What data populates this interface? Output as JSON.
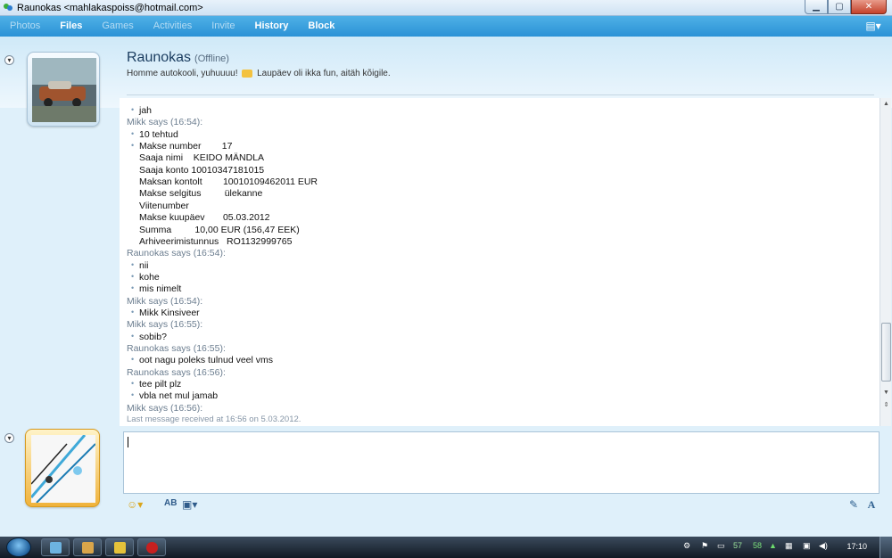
{
  "window": {
    "title": "Raunokas <mahlakaspoiss@hotmail.com>"
  },
  "menu": {
    "items": [
      "Photos",
      "Files",
      "Games",
      "Activities",
      "Invite",
      "History",
      "Block"
    ]
  },
  "contact": {
    "name": "Raunokas",
    "status": "(Offline)",
    "message_part1": "Homme autokooli, yuhuuuu!",
    "message_part2": "Laupäev oli ikka fun, aitäh kõigile."
  },
  "conversation": [
    {
      "type": "msg",
      "text": "jah"
    },
    {
      "type": "says",
      "text": "Mikk says (16:54):"
    },
    {
      "type": "msg",
      "text": "10 tehtud"
    },
    {
      "type": "msg",
      "text": "Makse number        17"
    },
    {
      "type": "cont",
      "text": "Saaja nimi    KEIDO MÄNDLA"
    },
    {
      "type": "cont",
      "text": "Saaja konto 10010347181015"
    },
    {
      "type": "cont",
      "text": "Maksan kontolt        10010109462011 EUR"
    },
    {
      "type": "cont",
      "text": "Makse selgitus         ülekanne"
    },
    {
      "type": "cont",
      "text": "Viitenumber"
    },
    {
      "type": "cont",
      "text": "Makse kuupäev       05.03.2012"
    },
    {
      "type": "cont",
      "text": "Summa         10,00 EUR (156,47 EEK)"
    },
    {
      "type": "cont",
      "text": "Arhiveerimistunnus   RO1132999765"
    },
    {
      "type": "says",
      "text": "Raunokas says (16:54):"
    },
    {
      "type": "msg",
      "text": "nii"
    },
    {
      "type": "msg",
      "text": "kohe"
    },
    {
      "type": "msg",
      "text": "mis nimelt"
    },
    {
      "type": "says",
      "text": "Mikk says (16:54):"
    },
    {
      "type": "msg",
      "text": "Mikk Kinsiveer"
    },
    {
      "type": "says",
      "text": "Mikk says (16:55):"
    },
    {
      "type": "msg",
      "text": "sobib?"
    },
    {
      "type": "says",
      "text": "Raunokas says (16:55):"
    },
    {
      "type": "msg",
      "text": "oot nagu poleks tulnud veel vms"
    },
    {
      "type": "says",
      "text": "Raunokas says (16:56):"
    },
    {
      "type": "msg",
      "text": "tee pilt plz"
    },
    {
      "type": "msg",
      "text": "vbla net mul jamab"
    },
    {
      "type": "says",
      "text": "Mikk says (16:56):"
    },
    {
      "type": "footer",
      "text": "Last message received at 16:56 on 5.03.2012."
    }
  ],
  "input": {
    "value": ""
  },
  "taskbar": {
    "tray_num1": "57",
    "tray_num2": "58",
    "clock": "17:10"
  },
  "colors": {
    "menubar": "#2a92d6",
    "accent": "#1b3d60"
  }
}
